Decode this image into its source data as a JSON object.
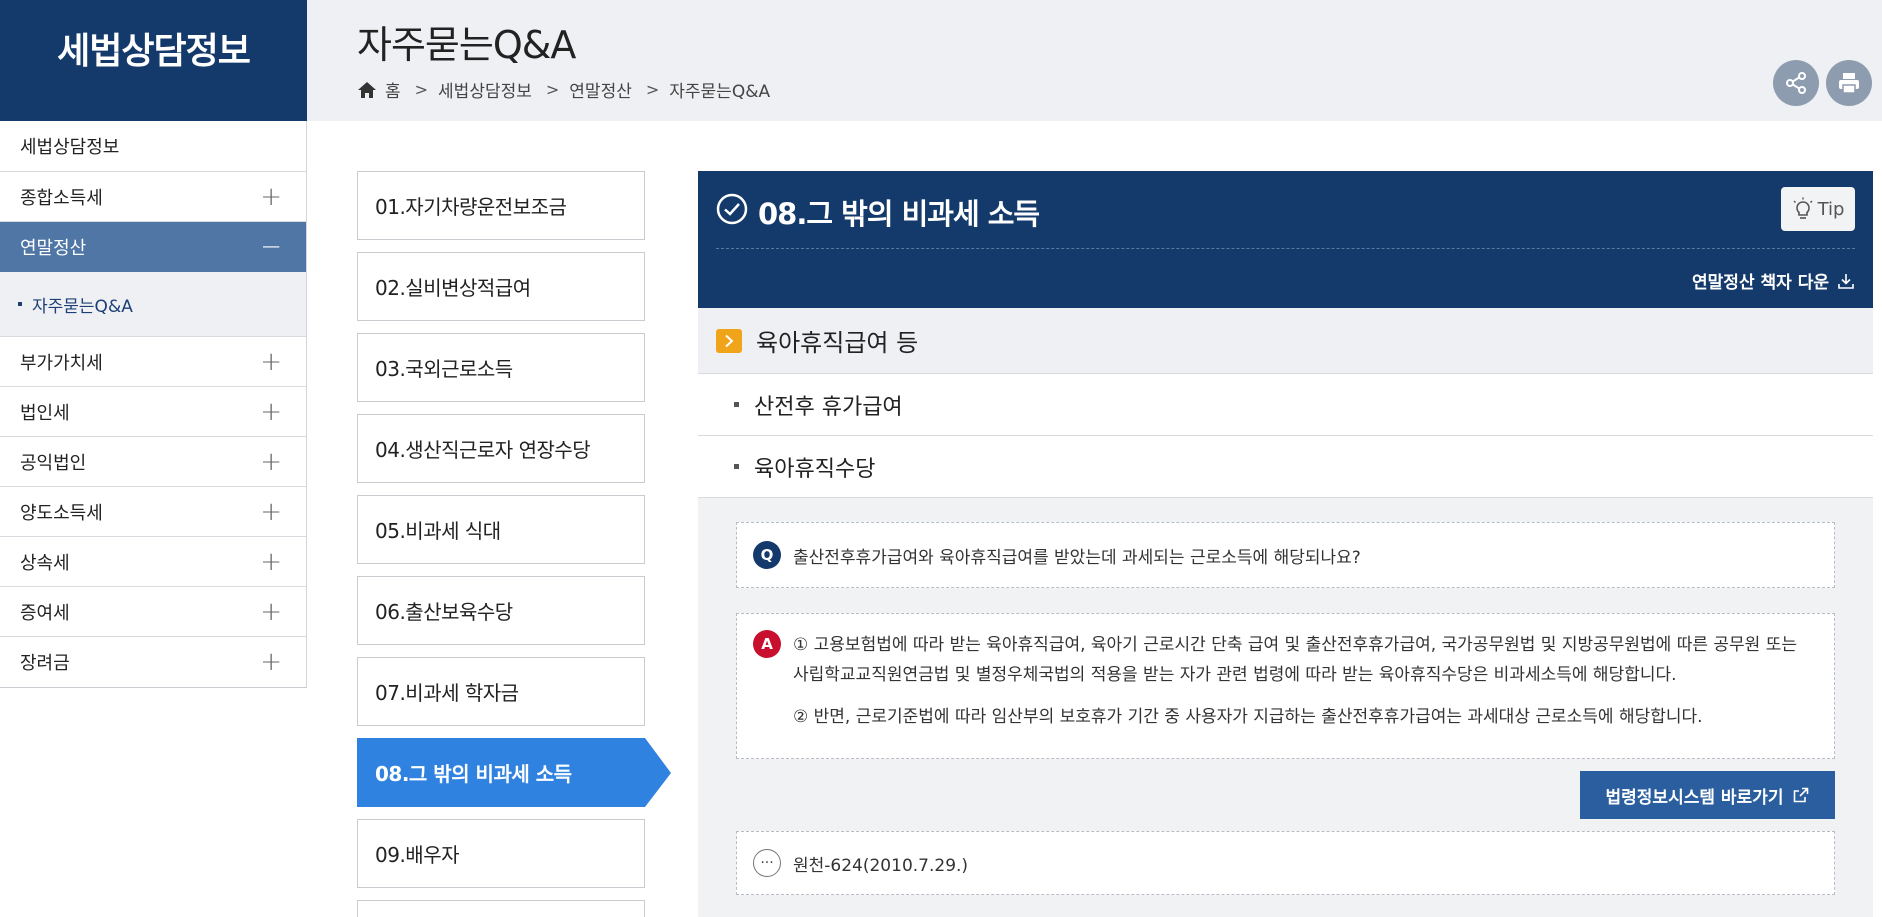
{
  "brand": {
    "title": "세법상담정보"
  },
  "header": {
    "title": "자주묻는Q&A",
    "breadcrumb": [
      "홈",
      "세법상담정보",
      "연말정산",
      "자주묻는Q&A"
    ]
  },
  "sidebar": {
    "items": [
      {
        "label": "세법상담정보"
      },
      {
        "label": "종합소득세",
        "toggle": "+"
      },
      {
        "label": "연말정산",
        "toggle": "−"
      },
      {
        "label": "자주묻는Q&A"
      },
      {
        "label": "부가가치세",
        "toggle": "+"
      },
      {
        "label": "법인세",
        "toggle": "+"
      },
      {
        "label": "공익법인",
        "toggle": "+"
      },
      {
        "label": "양도소득세",
        "toggle": "+"
      },
      {
        "label": "상속세",
        "toggle": "+"
      },
      {
        "label": "증여세",
        "toggle": "+"
      },
      {
        "label": "장려금",
        "toggle": "+"
      }
    ]
  },
  "categories": [
    "01.자기차량운전보조금",
    "02.실비변상적급여",
    "03.국외근로소득",
    "04.생산직근로자 연장수당",
    "05.비과세 식대",
    "06.출산보육수당",
    "07.비과세 학자금",
    "08.그 밖의 비과세 소득",
    "09.배우자"
  ],
  "content": {
    "title": "08.그 밖의 비과세 소득",
    "tip_label": "Tip",
    "download_label": "연말정산 책자 다운",
    "section_title": "육아휴직급여 등",
    "sub_items": [
      "산전후 휴가급여",
      "육아휴직수당"
    ],
    "question_badge": "Q",
    "question": "출산전후휴가급여와 육아휴직급여를 받았는데 과세되는 근로소득에 해당되나요?",
    "answer_badge": "A",
    "answer_1": "① 고용보험법에 따라 받는 육아휴직급여, 육아기 근로시간 단축 급여 및 출산전후휴가급여, 국가공무원법 및 지방공무원법에 따른 공무원 또는 사립학교교직원연금법 및 별정우체국법의 적용을 받는 자가 관련 법령에 따라 받는 육아휴직수당은 비과세소득에 해당합니다.",
    "answer_2": "② 반면, 근로기준법에 따라 임산부의 보호휴가 기간 중 사용자가 지급하는 출산전후휴가급여는 과세대상 근로소득에 해당합니다.",
    "law_button": "법령정보시스템 바로가기",
    "reference_icon": "···",
    "reference": "원천-624(2010.7.29.)"
  },
  "colors": {
    "navy": "#143a6b",
    "active_sidebar": "#4f76a5",
    "active_tab": "#2f82df",
    "chevron_badge": "#f0a41a",
    "answer_badge": "#c8102e",
    "law_button": "#2a5e9e"
  }
}
